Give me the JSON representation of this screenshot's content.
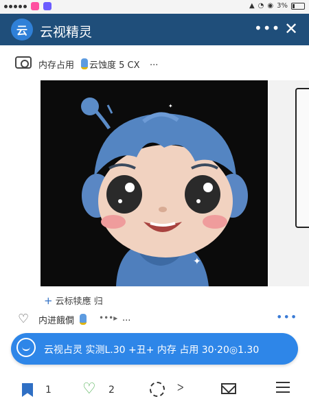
{
  "status_bar": {
    "battery": "3%",
    "app_colors": [
      "#ff4fa0",
      "#6b5cff",
      "#ffffff"
    ],
    "icons": [
      "signal-icon",
      "wifi-icon",
      "alarm-icon",
      "battery-icon"
    ]
  },
  "header": {
    "logo_text": "云",
    "title": "云视精灵",
    "more_label": "•••",
    "close_label": "✕",
    "bg_color": "#1f4e7a"
  },
  "memory_row": {
    "label": "内存占用",
    "value": "云蚀度 5 CX",
    "more": "...",
    "camera_icon": "camera-icon"
  },
  "photo": {
    "subject": "cartoon-boy-blue-hoodie-headphones"
  },
  "caption": {
    "plus": "+",
    "text": "云标犊應 归"
  },
  "like_row": {
    "label": "内进餓僴",
    "arrows": "•••▸",
    "more": "...",
    "dots": "•••"
  },
  "banner": {
    "text": "云视占灵  实测L.30 +丑+ 内存 占用  30·20◎1.30",
    "bg_color": "#2e86e8"
  },
  "bottom_nav": {
    "bookmark_count": "1",
    "like_count": "2",
    "translate_label": "ᐳ",
    "icons": [
      "bookmark-icon",
      "heart-icon",
      "refresh-icon",
      "translate-icon",
      "mail-icon",
      "menu-icon"
    ]
  }
}
